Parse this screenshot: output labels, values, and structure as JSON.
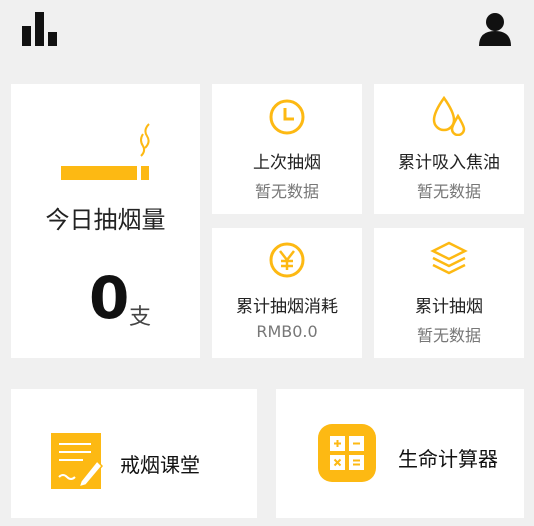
{
  "colors": {
    "accent": "#FDB913",
    "background": "#f0f0f0",
    "card": "#ffffff"
  },
  "topbar": {
    "left_icon": "bar-chart-icon",
    "right_icon": "user-icon"
  },
  "today": {
    "title": "今日抽烟量",
    "count": "0",
    "unit": "支",
    "icon": "cigarette-icon"
  },
  "stats": [
    {
      "title": "上次抽烟",
      "value": "暂无数据",
      "icon": "clock-icon"
    },
    {
      "title": "累计吸入焦油",
      "value": "暂无数据",
      "icon": "droplets-icon"
    },
    {
      "title": "累计抽烟消耗",
      "value": "RMB0.0",
      "icon": "yen-icon"
    },
    {
      "title": "累计抽烟",
      "value": "暂无数据",
      "icon": "layers-icon"
    }
  ],
  "bottom": [
    {
      "label": "戒烟课堂",
      "icon": "notepad-icon"
    },
    {
      "label": "生命计算器",
      "icon": "calculator-icon"
    }
  ]
}
